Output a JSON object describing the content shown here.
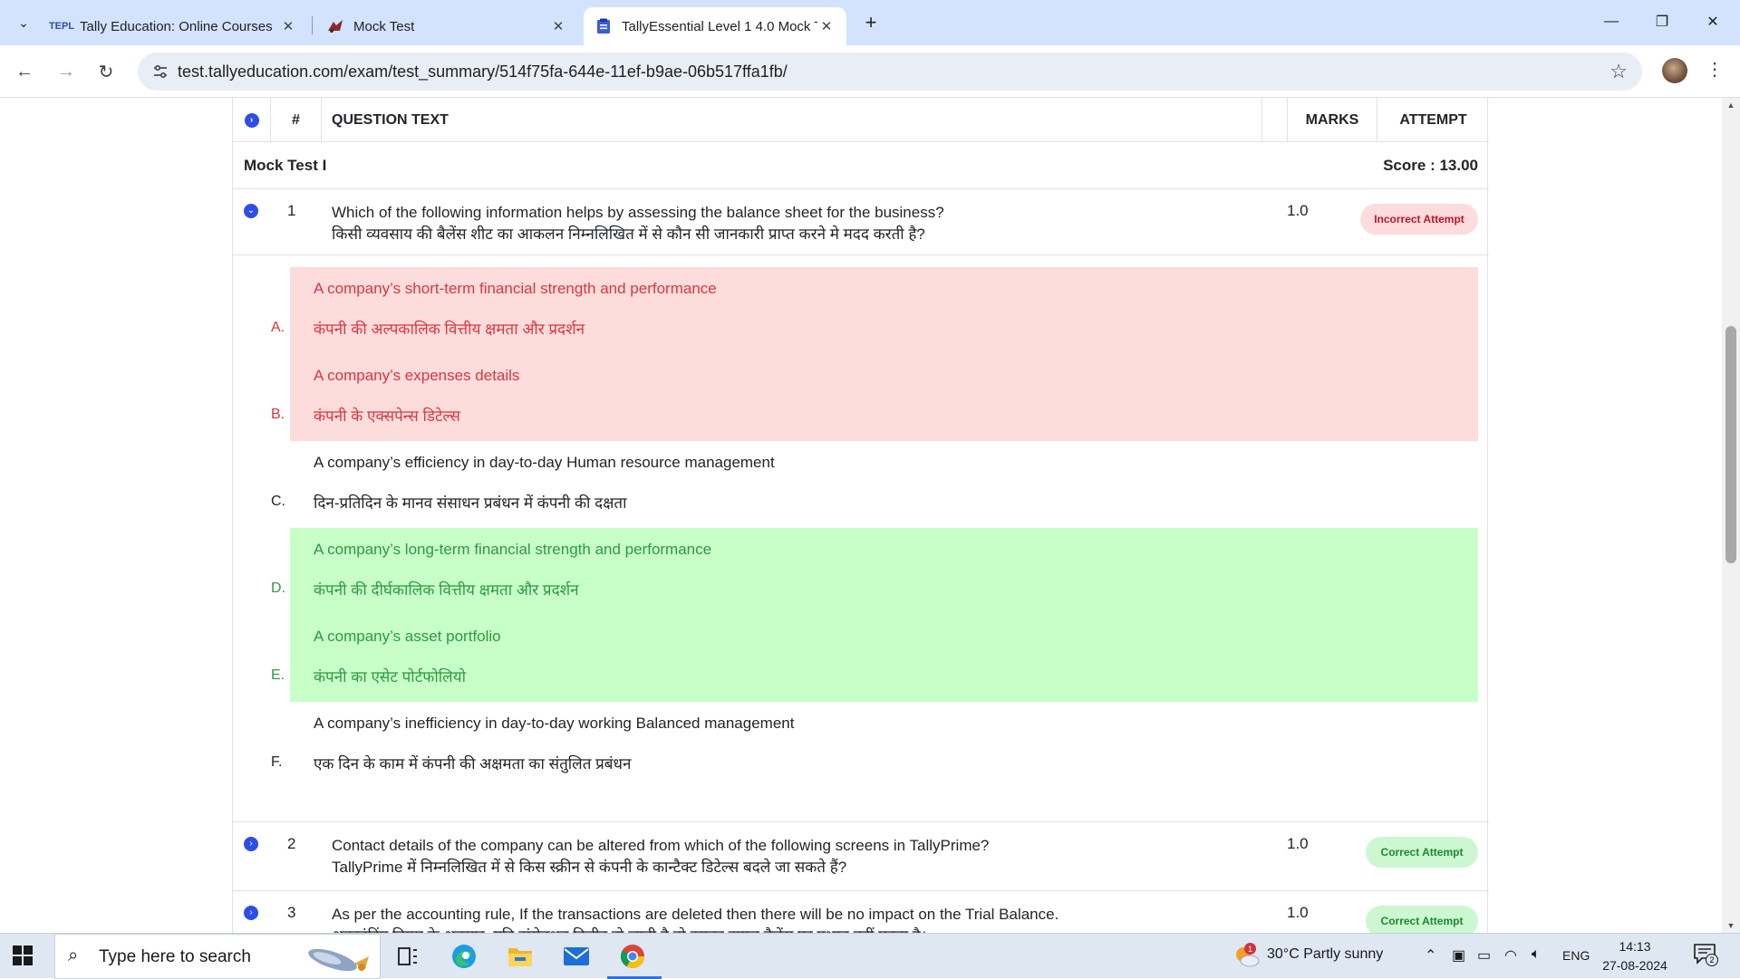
{
  "tabs": [
    {
      "title": "Tally Education: Online Courses",
      "favicon": "TEPL"
    },
    {
      "title": "Mock Test",
      "favicon": "mock-test-favicon"
    },
    {
      "title": "TallyEssential Level 1 4.0 Mock T",
      "favicon": "clipboard-favicon",
      "active": true
    }
  ],
  "address": {
    "url": "test.tallyeducation.com/exam/test_summary/514f75fa-644e-11ef-b9ae-06b517ffa1fb/"
  },
  "table": {
    "headers": {
      "num": "#",
      "question": "QUESTION TEXT",
      "marks": "MARKS",
      "attempt": "ATTEMPT"
    },
    "section_title": "Mock Test I",
    "score": "Score : 13.00"
  },
  "questions": [
    {
      "num": "1",
      "text_en": "Which of the following information helps by assessing the balance sheet for the business?",
      "text_hi": "किसी व्यवसाय की बैलेंस शीट का आकलन निम्नलिखित में से कौन सी जानकारी प्राप्त करने मे मदद करती है?",
      "marks": "1.0",
      "status": "Incorrect Attempt",
      "options": [
        {
          "letter": "A.",
          "en": "A company’s short-term financial strength and performance",
          "hi": "कंपनी की अल्पकालिक वित्तीय क्षमता और प्रदर्शन",
          "state": "wrong"
        },
        {
          "letter": "B.",
          "en": "A company’s  expenses details",
          "hi": "कंपनी के एक्सपेन्स डिटेल्स",
          "state": "wrong"
        },
        {
          "letter": "C.",
          "en": "A company’s efficiency in day-to-day Human resource management",
          "hi": "दिन-प्रतिदिन के मानव संसाधन प्रबंधन में कंपनी की दक्षता",
          "state": "neutral"
        },
        {
          "letter": "D.",
          "en": "A company’s long-term financial strength and performance",
          "hi": "कंपनी की दीर्घकालिक वित्तीय क्षमता और प्रदर्शन",
          "state": "right"
        },
        {
          "letter": "E.",
          "en": "A company’s asset portfolio",
          "hi": "कंपनी का एसेट पोर्टफोलियो",
          "state": "right"
        },
        {
          "letter": "F.",
          "en": "A company’s inefficiency in day-to-day working Balanced management",
          "hi": "एक दिन के काम में कंपनी की अक्षमता का संतुलित प्रबंधन",
          "state": "neutral"
        }
      ]
    },
    {
      "num": "2",
      "text_en": "Contact details of the company can be altered from which of the following screens in TallyPrime?",
      "text_hi": "TallyPrime में निम्नलिखित में से किस स्क्रीन से कंपनी के कान्टैक्ट डिटेल्स बदले जा सकते हैं?",
      "marks": "1.0",
      "status": "Correct Attempt"
    },
    {
      "num": "3",
      "text_en": "As per the accounting rule, If the transactions are deleted then there will be no impact on the Trial Balance.",
      "text_hi": "अकाउंटिंग नियम के अनुसार, यदि ट्रांसेक्शन डिलीट हो जाती है तो इसका ट्रायल बैलेंस पर प्रभाव नहीं पड़ता है।",
      "marks": "1.0",
      "status": "Correct Attempt"
    }
  ],
  "taskbar": {
    "search_placeholder": "Type here to search",
    "weather": "30°C  Partly sunny",
    "weather_badge": "1",
    "language": "ENG",
    "time": "14:13",
    "date": "27-08-2024",
    "notification_count": "2"
  },
  "colors": {
    "accent": "#2d4ee6",
    "wrong_bg": "#fddcdc",
    "wrong_text": "#d9383e",
    "right_bg": "#c8ffc8",
    "right_text": "#2d9a43"
  }
}
